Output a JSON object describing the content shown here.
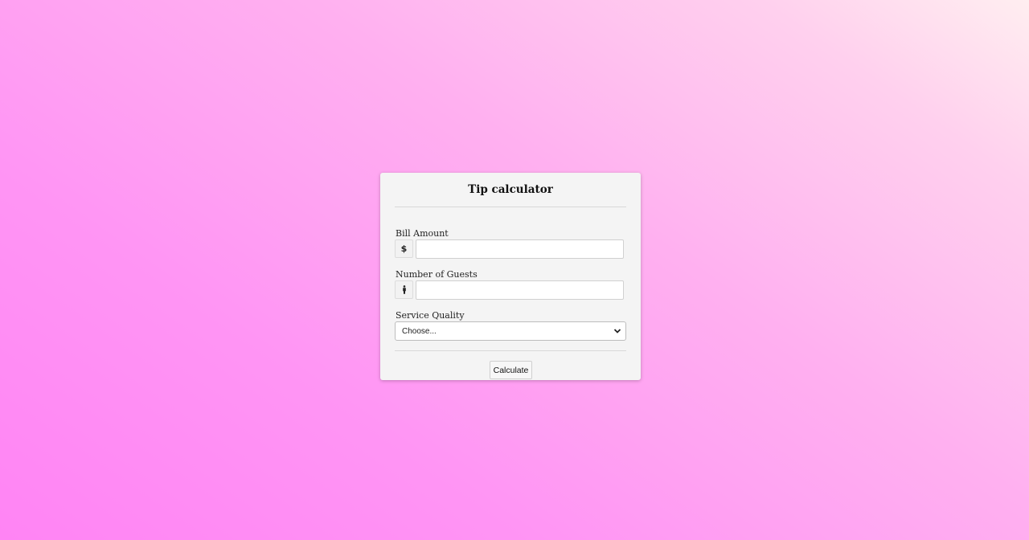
{
  "card": {
    "title": "Tip calculator",
    "bill": {
      "label": "Bill Amount",
      "addon": "$",
      "value": "",
      "placeholder": ""
    },
    "guests": {
      "label": "Number of Guests",
      "addon_icon": "person-icon",
      "value": "",
      "placeholder": ""
    },
    "service": {
      "label": "Service Quality",
      "selected": "Choose..."
    },
    "calculate_label": "Calculate"
  },
  "colors": {
    "background_start": "#ff84f4",
    "background_end": "#ffeef0",
    "card": "#f4f4f4"
  }
}
